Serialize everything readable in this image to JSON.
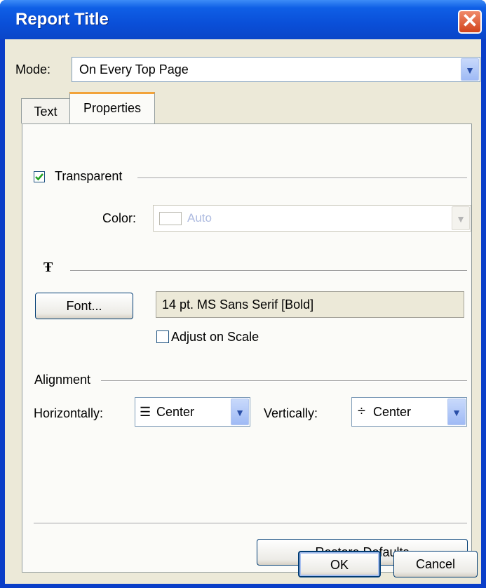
{
  "window": {
    "title": "Report Title"
  },
  "mode": {
    "label": "Mode:",
    "value": "On Every Top Page"
  },
  "tabs": [
    {
      "label": "Text"
    },
    {
      "label": "Properties"
    }
  ],
  "transparent": {
    "label": "Transparent",
    "checked": true
  },
  "color": {
    "label": "Color:",
    "value": "Auto"
  },
  "font_section": {
    "icon": "T-T"
  },
  "font": {
    "button_label": "Font...",
    "value": "14 pt. MS Sans Serif  [Bold]"
  },
  "adjust_on_scale": {
    "label": "Adjust on Scale",
    "checked": false
  },
  "alignment": {
    "title": "Alignment",
    "horizontal_label": "Horizontally:",
    "horizontal_value": "Center",
    "vertical_label": "Vertically:",
    "vertical_value": "Center"
  },
  "buttons": {
    "restore": "Restore Defaults",
    "ok": "OK",
    "cancel": "Cancel"
  },
  "colors": {
    "title_bar": "#0a4fd8",
    "dialog_bg": "#ece9d8",
    "close": "#d2441c"
  }
}
